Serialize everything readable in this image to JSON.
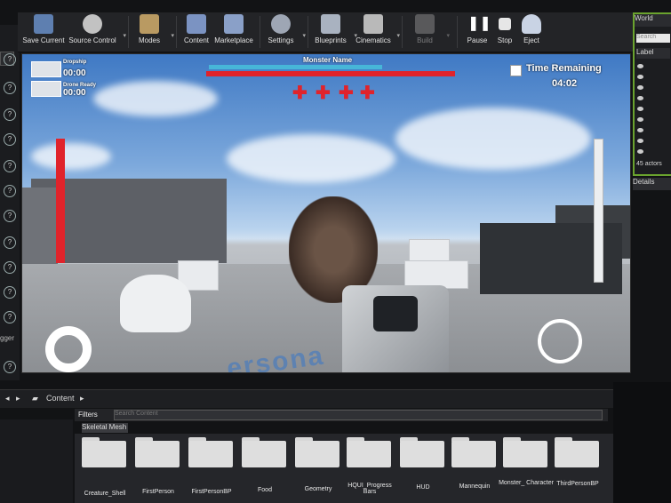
{
  "toolbar": {
    "items": [
      {
        "label": "Save Current",
        "icon": "save-icon"
      },
      {
        "label": "Source Control",
        "icon": "source-control-icon"
      },
      {
        "label": "Modes",
        "icon": "modes-icon"
      },
      {
        "label": "Content",
        "icon": "content-icon"
      },
      {
        "label": "Marketplace",
        "icon": "marketplace-icon"
      },
      {
        "label": "Settings",
        "icon": "settings-icon"
      },
      {
        "label": "Blueprints",
        "icon": "blueprints-icon"
      },
      {
        "label": "Cinematics",
        "icon": "cinematics-icon"
      },
      {
        "label": "Build",
        "icon": "build-icon"
      },
      {
        "label": "Pause",
        "icon": "pause-icon"
      },
      {
        "label": "Stop",
        "icon": "stop-icon"
      },
      {
        "label": "Eject",
        "icon": "eject-icon"
      }
    ]
  },
  "hud": {
    "dropship_label": "Dropship",
    "dropship_time": "00:00",
    "drone_label": "Drone Ready",
    "drone_time": "00:00",
    "monster_name": "Monster Name",
    "time_remaining_label": "Time Remaining",
    "time_remaining_value": "04:02",
    "crosses": [
      "✚",
      "✚",
      "✚",
      "✚"
    ],
    "floor_text": "ersona"
  },
  "outliner": {
    "tab": "World",
    "search_placeholder": "Search",
    "column_label": "Label",
    "actor_count": "45 actors",
    "details_tab": "Details"
  },
  "left_strip": {
    "partial_label": "gger"
  },
  "content_browser": {
    "breadcrumb": "Content",
    "filters_label": "Filters",
    "search_placeholder": "Search Content",
    "active_filter": "Skeletal Mesh",
    "folders": [
      "Creature_Shell",
      "FirstPerson",
      "FirstPersonBP",
      "Food",
      "Geometry",
      "HQUI_Progress Bars",
      "HUD",
      "Mannequin",
      "Monster_ Character",
      "ThirdPersonBP"
    ]
  },
  "colors": {
    "health_red": "#e0232b",
    "health_cyan": "#47b6d8",
    "outliner_border": "#6aa32e"
  }
}
